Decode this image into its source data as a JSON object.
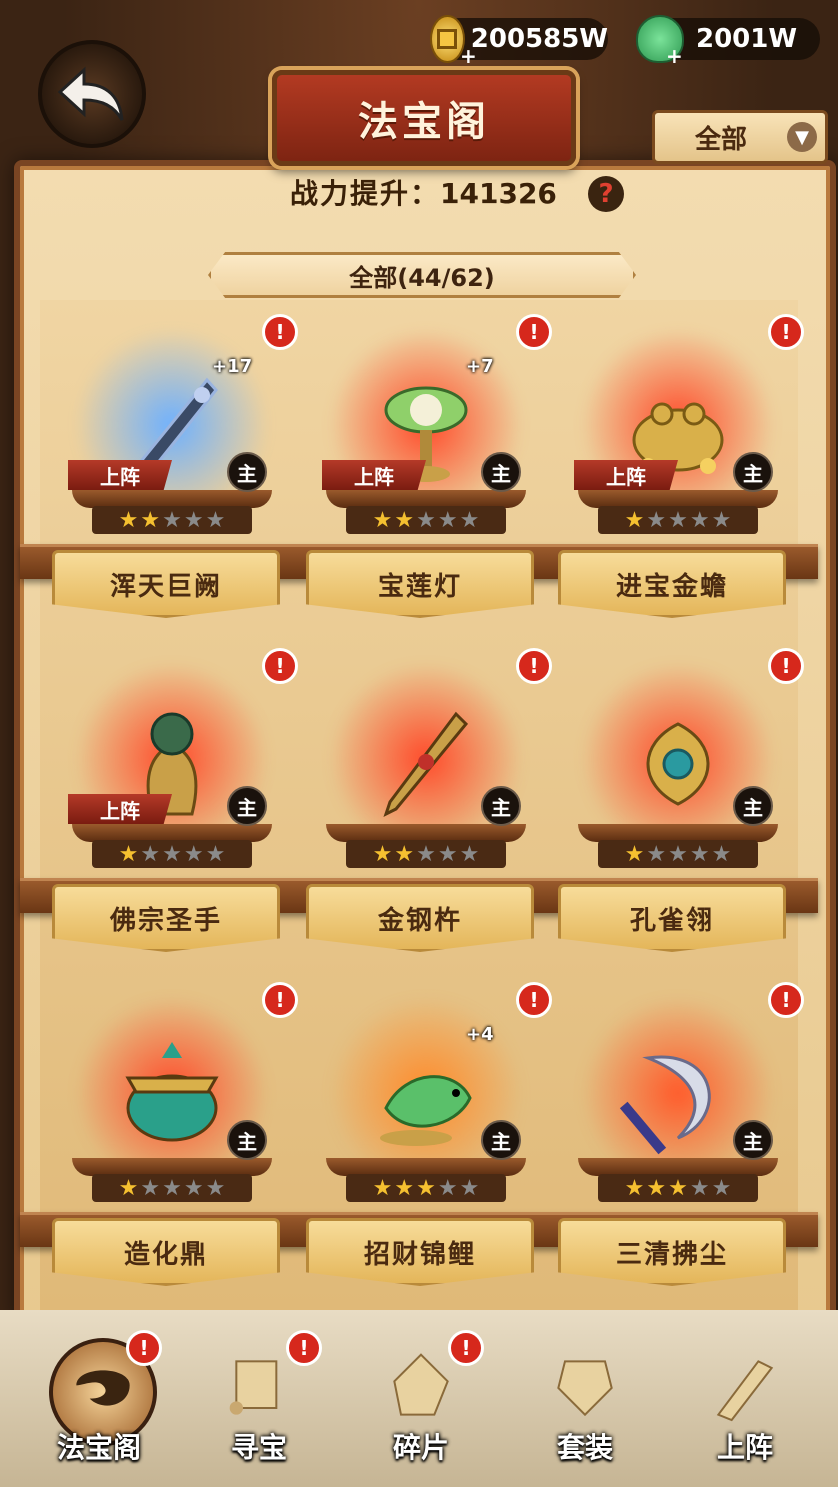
{
  "header": {
    "title": "法宝阁",
    "coins": "200585W",
    "jade": "2001W",
    "filter": {
      "selected": "全部"
    },
    "power_label": "战力提升：",
    "power_value": "141326",
    "help_symbol": "?",
    "category": "全部(44/62)"
  },
  "items": [
    {
      "name": "浑天巨阙",
      "level": "+17",
      "deployed": true,
      "deploy_label": "上阵",
      "main_label": "主",
      "stars": 2,
      "glow": "#6db0ff",
      "icon": "sword-icon"
    },
    {
      "name": "宝莲灯",
      "level": "+7",
      "deployed": true,
      "deploy_label": "上阵",
      "main_label": "主",
      "stars": 2,
      "glow": "#ff4a2a",
      "icon": "lotus-lamp-icon"
    },
    {
      "name": "进宝金蟾",
      "level": "",
      "deployed": true,
      "deploy_label": "上阵",
      "main_label": "主",
      "stars": 1,
      "glow": "#ff4a2a",
      "icon": "golden-toad-icon"
    },
    {
      "name": "佛宗圣手",
      "level": "",
      "deployed": true,
      "deploy_label": "上阵",
      "main_label": "主",
      "stars": 1,
      "glow": "#ff4a2a",
      "icon": "buddha-hand-icon"
    },
    {
      "name": "金钢杵",
      "level": "",
      "deployed": false,
      "deploy_label": "",
      "main_label": "主",
      "stars": 2,
      "glow": "#ff4a2a",
      "icon": "vajra-icon"
    },
    {
      "name": "孔雀翎",
      "level": "",
      "deployed": false,
      "deploy_label": "",
      "main_label": "主",
      "stars": 1,
      "glow": "#ff4a2a",
      "icon": "peacock-feather-icon"
    },
    {
      "name": "造化鼎",
      "level": "",
      "deployed": false,
      "deploy_label": "",
      "main_label": "主",
      "stars": 1,
      "glow": "#ff4a2a",
      "icon": "cauldron-icon"
    },
    {
      "name": "招财锦鲤",
      "level": "+4",
      "deployed": false,
      "deploy_label": "",
      "main_label": "主",
      "stars": 3,
      "glow": "#ff8a2a",
      "icon": "koi-fish-icon"
    },
    {
      "name": "三清拂尘",
      "level": "",
      "deployed": false,
      "deploy_label": "",
      "main_label": "主",
      "stars": 3,
      "glow": "#ff5a2a",
      "icon": "whisk-icon"
    }
  ],
  "alert_symbol": "!",
  "nav": [
    {
      "label": "法宝阁",
      "icon": "treasure-pavilion-icon",
      "active": true,
      "alert": true
    },
    {
      "label": "寻宝",
      "icon": "scroll-icon",
      "active": false,
      "alert": true
    },
    {
      "label": "碎片",
      "icon": "fragment-icon",
      "active": false,
      "alert": true
    },
    {
      "label": "套装",
      "icon": "armor-set-icon",
      "active": false,
      "alert": false
    },
    {
      "label": "上阵",
      "icon": "deploy-icon",
      "active": false,
      "alert": false
    }
  ]
}
